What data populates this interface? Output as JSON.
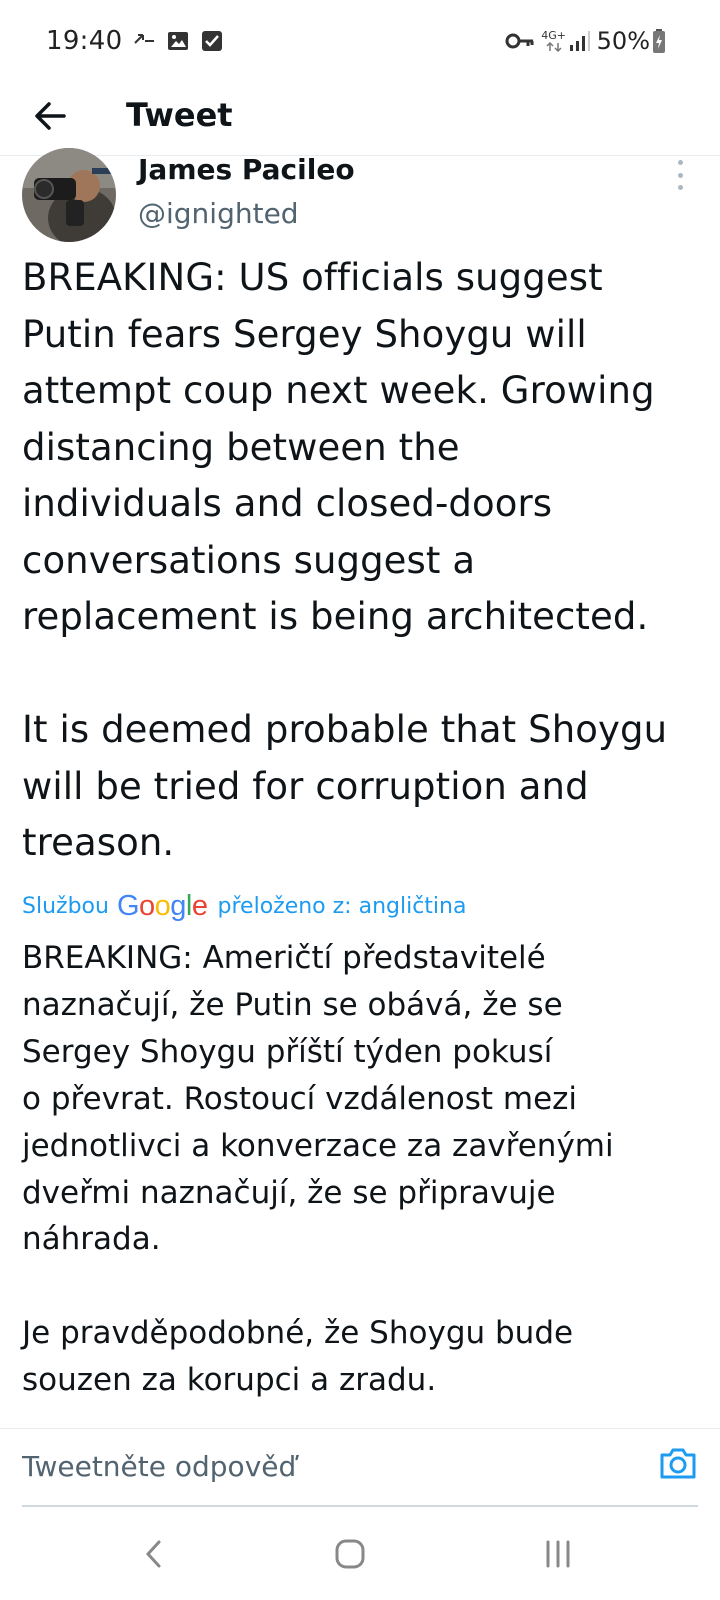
{
  "status_bar": {
    "time": "19:40",
    "battery": "50%",
    "icons": [
      "call-forward-icon",
      "image-icon",
      "checkbox-icon",
      "vpn-key-icon",
      "4g-plus-icon",
      "signal-icon",
      "battery-charging-icon"
    ],
    "network_label": "4G+"
  },
  "app_bar": {
    "title": "Tweet",
    "back_icon": "arrow-left-icon"
  },
  "tweet": {
    "author_name": "James Pacileo",
    "handle": "@ignighted",
    "text": "BREAKING: US officials suggest\nPutin fears Sergey Shoygu will\nattempt coup next week. Growing\ndistancing between the\nindividuals and closed-doors\nconversations suggest a\nreplacement is being architected.\n\nIt is deemed probable that Shoygu\nwill be tried for corruption and\ntreason.",
    "translation": {
      "prefix": "Službou",
      "provider": "Google",
      "suffix": "přeloženo z: angličtina",
      "text": "BREAKING: Američtí představitelé\nnaznačují, že Putin se obává, že se\nSergey Shoygu příští týden pokusí\no převrat. Rostoucí vzdálenost mezi\njednotlivci a konverzace za zavřenými\ndveřmi naznačují, že se připravuje\nnáhrada.\n\n Je pravděpodobné, že Shoygu bude\nsouzen za korupci a zradu."
    }
  },
  "reply": {
    "placeholder": "Tweetněte odpověď"
  },
  "colors": {
    "accent": "#1d9bf0",
    "text_primary": "#0f1419",
    "text_secondary": "#536471",
    "divider": "#e6ecf0"
  }
}
